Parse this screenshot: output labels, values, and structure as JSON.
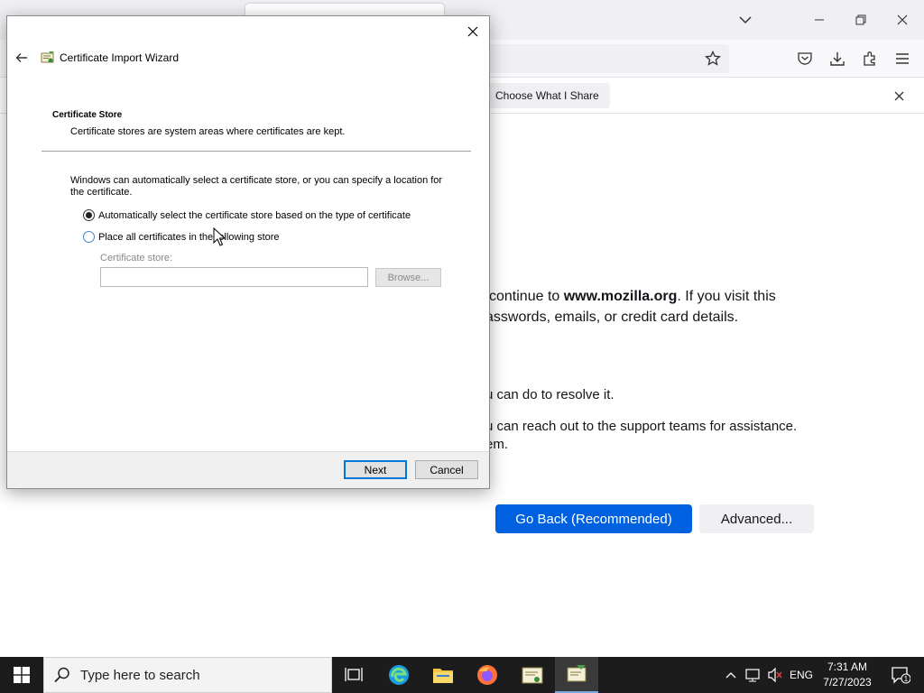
{
  "browser": {
    "notification": {
      "choose_label": "Choose What I Share"
    },
    "page": {
      "line1_pre": "continue to ",
      "line1_domain": "www.mozilla.org",
      "line1_post": ". If you visit this",
      "line2": "asswords, emails, or credit card details.",
      "line3": "u can do to resolve it.",
      "line4": "u can reach out to the support teams for assistance.",
      "line5": "em.",
      "go_back_label": "Go Back (Recommended)",
      "advanced_label": "Advanced..."
    }
  },
  "wizard": {
    "title": "Certificate Import Wizard",
    "section_heading": "Certificate Store",
    "section_sub": "Certificate stores are system areas where certificates are kept.",
    "description": "Windows can automatically select a certificate store, or you can specify a location for the certificate.",
    "radio_auto_label": "Automatically select the certificate store based on the type of certificate",
    "radio_manual_label": "Place all certificates in the following store",
    "store_label": "Certificate store:",
    "store_value": "",
    "browse_label": "Browse...",
    "next_label": "Next",
    "cancel_label": "Cancel",
    "selected_option": "auto"
  },
  "taskbar": {
    "search_placeholder": "Type here to search",
    "language": "ENG",
    "time": "7:31 AM",
    "date": "7/27/2023",
    "notification_count": "1"
  },
  "colors": {
    "primary_button": "#0061e0",
    "focus_border": "#0078d7",
    "taskbar_bg": "#1c1c1c"
  }
}
